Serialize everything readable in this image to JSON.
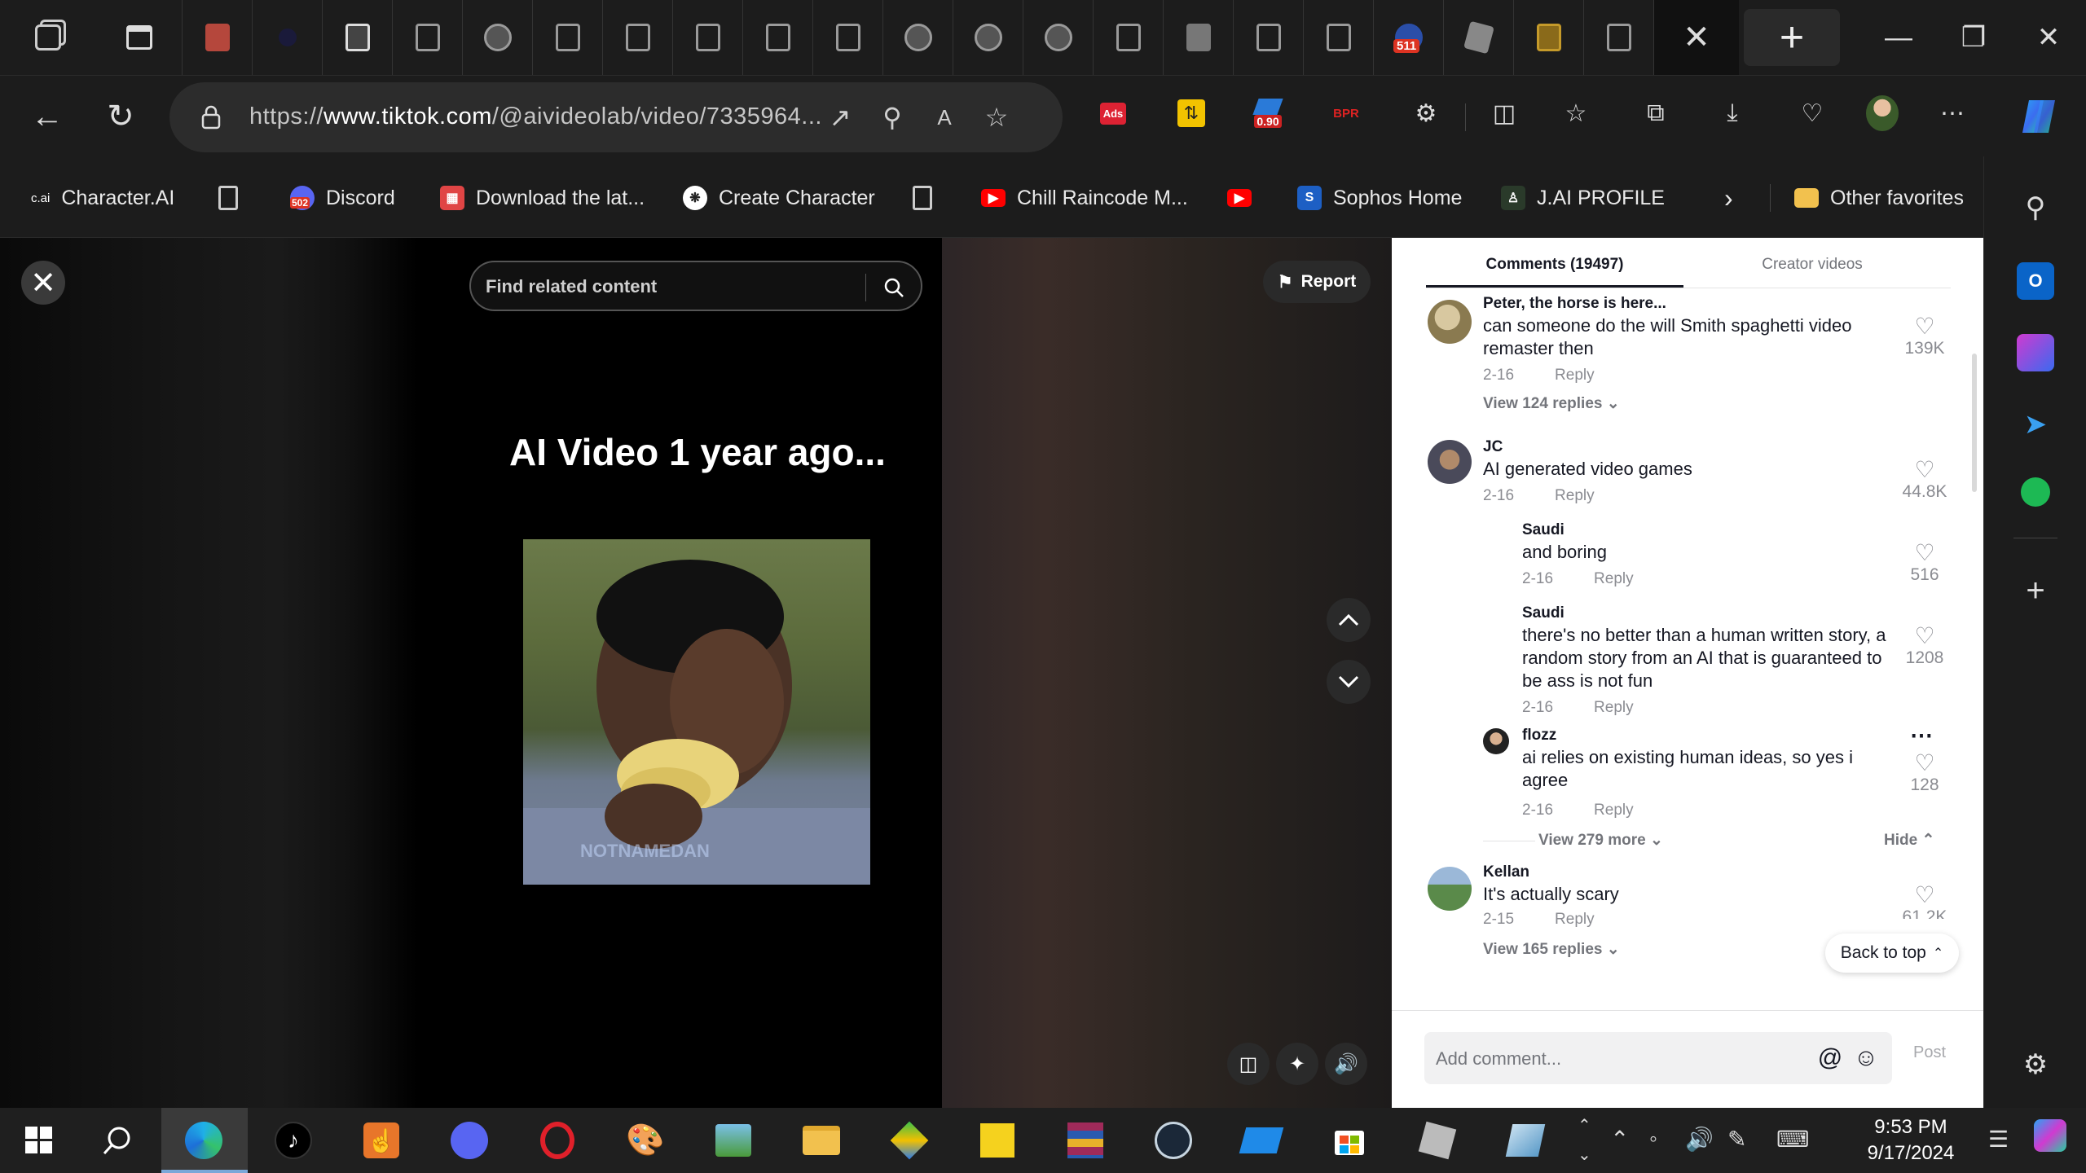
{
  "browser": {
    "url_prefix": "https://",
    "url_domain": "www.tiktok.com",
    "url_rest": "/@aivideolab/video/7335964...",
    "window_controls": {
      "minimize": "—",
      "restore": "❐",
      "close": "✕"
    },
    "new_tab_label": "+",
    "active_tab_close": "✕",
    "extension_badges": {
      "ads": "Ads",
      "price": "0.90",
      "bpr": "BPR",
      "tab_badge": "511"
    }
  },
  "favorites": {
    "items": [
      {
        "label": "Character.AI",
        "icon": "c.ai"
      },
      {
        "label": "",
        "icon": "page-icon"
      },
      {
        "label": "Discord",
        "icon": "502"
      },
      {
        "label": "Download the lat...",
        "icon": "calendar-icon"
      },
      {
        "label": "Create Character",
        "icon": "openai-icon"
      },
      {
        "label": "",
        "icon": "page-icon"
      },
      {
        "label": "Chill Raincode M...",
        "icon": "youtube-icon"
      },
      {
        "label": "",
        "icon": "youtube-icon"
      },
      {
        "label": "Sophos Home",
        "icon": "S"
      },
      {
        "label": "J.AI PROFILE",
        "icon": "janitor-icon"
      }
    ],
    "other_favorites": "Other favorites"
  },
  "tiktok": {
    "search_placeholder": "Find related content",
    "report_label": "Report",
    "video_caption": "AI Video 1 year ago...",
    "watermark": "NOTNAMEDAN"
  },
  "comments_panel": {
    "tab_comments": "Comments (19497)",
    "tab_creator": "Creator videos",
    "reply_label": "Reply",
    "comments": [
      {
        "user": "Peter, the horse is here...",
        "text": "can someone do the will Smith spaghetti video remaster then",
        "date": "2-16",
        "likes": "139K",
        "view_replies": "View 124 replies"
      },
      {
        "user": "JC",
        "text": "AI generated video games",
        "date": "2-16",
        "likes": "44.8K"
      },
      {
        "user": "Saudi",
        "text": "and boring",
        "date": "2-16",
        "likes": "516"
      },
      {
        "user": "Saudi",
        "text": "there's no better than a human written story, a random story from an AI that is guaranteed to be ass is not fun",
        "date": "2-16",
        "likes": "1208"
      },
      {
        "user": "flozz",
        "text": "ai relies on existing human ideas, so yes i agree",
        "date": "2-16",
        "likes": "128"
      },
      {
        "user": "Kellan",
        "text": "It's actually scary",
        "date": "2-15",
        "likes": "61.2K",
        "view_replies": "View 165 replies"
      }
    ],
    "view_more": "View 279 more",
    "hide": "Hide",
    "back_to_top": "Back to top",
    "comment_placeholder": "Add comment...",
    "post_label": "Post"
  },
  "taskbar": {
    "time": "9:53 PM",
    "date": "9/17/2024"
  }
}
